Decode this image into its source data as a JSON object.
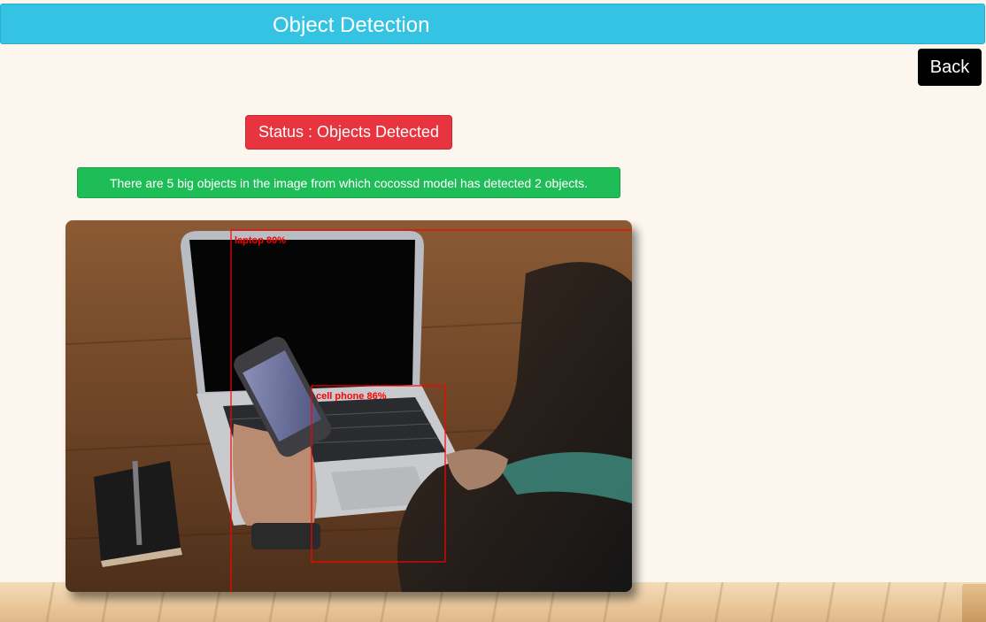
{
  "header": {
    "title": "Object Detection"
  },
  "nav": {
    "back_label": "Back"
  },
  "status": {
    "text": "Status : Objects Detected"
  },
  "info": {
    "text": "There are 5 big objects in the image from which cocossd model has detected 2 objects."
  },
  "detections": [
    {
      "label": "laptop 80%"
    },
    {
      "label": "cell phone 86%"
    }
  ],
  "colors": {
    "header": "#34c3e2",
    "status": "#e8343e",
    "info": "#1fbd57",
    "box": "#ff0000",
    "background": "#fdf6ee"
  }
}
